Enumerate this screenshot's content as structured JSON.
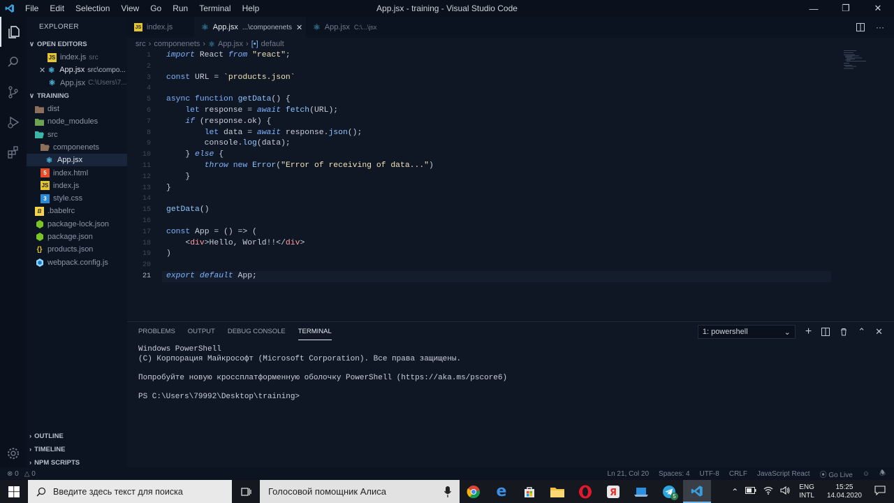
{
  "window": {
    "title": "App.jsx - training - Visual Studio Code",
    "menu": [
      "File",
      "Edit",
      "Selection",
      "View",
      "Go",
      "Run",
      "Terminal",
      "Help"
    ]
  },
  "sidebar": {
    "header": "EXPLORER",
    "open_editors_label": "OPEN EDITORS",
    "open_editors": [
      {
        "name": "index.js",
        "path": "src"
      },
      {
        "name": "App.jsx",
        "path": "src\\compo..."
      },
      {
        "name": "App.jsx",
        "path": "C:\\Users\\7..."
      }
    ],
    "project_label": "TRAINING",
    "tree": [
      {
        "name": "dist"
      },
      {
        "name": "node_modules"
      },
      {
        "name": "src"
      },
      {
        "name": "componenets"
      },
      {
        "name": "App.jsx"
      },
      {
        "name": "index.html"
      },
      {
        "name": "index.js"
      },
      {
        "name": "style.css"
      },
      {
        "name": ".babelrc"
      },
      {
        "name": "package-lock.json"
      },
      {
        "name": "package.json"
      },
      {
        "name": "products.json"
      },
      {
        "name": "webpack.config.js"
      }
    ],
    "outline": "OUTLINE",
    "timeline": "TIMELINE",
    "npm_scripts": "NPM SCRIPTS"
  },
  "tabs": [
    {
      "name": "index.js",
      "path": ""
    },
    {
      "name": "App.jsx",
      "path": "...\\componenets"
    },
    {
      "name": "App.jsx",
      "path": "C:\\...\\jsx"
    }
  ],
  "breadcrumb": [
    "src",
    "componenets",
    "App.jsx",
    "default"
  ],
  "editor": {
    "line_numbers": [
      "1",
      "2",
      "3",
      "4",
      "5",
      "6",
      "7",
      "8",
      "9",
      "10",
      "11",
      "12",
      "13",
      "14",
      "15",
      "16",
      "17",
      "18",
      "19",
      "20",
      "21"
    ]
  },
  "panel": {
    "tabs": [
      "PROBLEMS",
      "OUTPUT",
      "DEBUG CONSOLE",
      "TERMINAL"
    ],
    "terminal_select": "1: powershell",
    "terminal_lines": [
      "Windows PowerShell",
      "(C) Корпорация Майкрософт (Microsoft Corporation). Все права защищены.",
      "",
      "Попробуйте новую кроссплатформенную оболочку PowerShell (https://aka.ms/pscore6)",
      "",
      "PS C:\\Users\\79992\\Desktop\\training>"
    ]
  },
  "status": {
    "errors": "0",
    "warnings": "0",
    "position": "Ln 21, Col 20",
    "spaces": "Spaces: 4",
    "encoding": "UTF-8",
    "eol": "CRLF",
    "language": "JavaScript React",
    "golive": "Go Live"
  },
  "taskbar": {
    "search_placeholder": "Введите здесь текст для поиска",
    "alice": "Голосовой помощник Алиса",
    "lang1": "ENG",
    "lang2": "INTL",
    "time": "15:25",
    "date": "14.04.2020",
    "telegram_badge": "5"
  }
}
